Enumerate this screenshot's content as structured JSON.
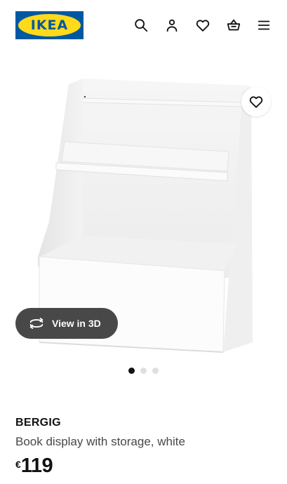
{
  "header": {
    "logo_text": "IKEA",
    "icons": [
      "search-icon",
      "user-icon",
      "heart-icon",
      "basket-icon",
      "menu-icon"
    ]
  },
  "gallery": {
    "view3d_label": "View in 3D",
    "dots_total": 3,
    "active_dot": 1
  },
  "product": {
    "name": "BERGIG",
    "description": "Book display with storage, white",
    "currency": "€",
    "price": "119"
  },
  "colors": {
    "brand_blue": "#0058a3",
    "brand_yellow": "#ffda1a",
    "pill_background": "#484848"
  }
}
